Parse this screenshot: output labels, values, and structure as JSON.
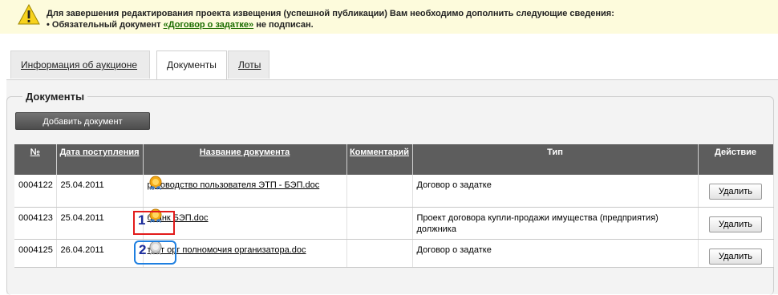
{
  "warning": {
    "line1": "Для завершения редактирования проекта извещения (успешной публикации) Вам необходимо дополнить следующие сведения:",
    "line2_prefix": "• Обязательный документ ",
    "line2_link": "«Договор о задатке»",
    "line2_suffix": " не подписан."
  },
  "tabs": [
    {
      "label": "Информация об аукционе",
      "active": false
    },
    {
      "label": "Документы",
      "active": true
    },
    {
      "label": "Лоты",
      "active": false
    }
  ],
  "section": {
    "title": "Документы",
    "add_button": "Добавить документ"
  },
  "table": {
    "headers": {
      "num": "№",
      "date": "Дата поступления",
      "name": "Название документа",
      "comment": "Комментарий",
      "type": "Тип",
      "action": "Действие"
    },
    "rows": [
      {
        "num": "0004122",
        "date": "25.04.2011",
        "name": "руководство пользователя ЭТП - БЭП.doc",
        "comment": "",
        "type": "Договор о задатке",
        "action": "Удалить",
        "signed": true
      },
      {
        "num": "0004123",
        "date": "25.04.2011",
        "name": "бланк БЭП.doc",
        "comment": "",
        "type": "Проект договора купли-продажи имущества (предприятия) должника",
        "action": "Удалить",
        "signed": true
      },
      {
        "num": "0004125",
        "date": "26.04.2011",
        "name": "тест орг полномочия организатора.doc",
        "comment": "",
        "type": "Договор о задатке",
        "action": "Удалить",
        "signed": false
      }
    ]
  },
  "annotations": {
    "marker1": "1",
    "marker2": "2"
  },
  "colors": {
    "warning_bg": "#fdfbdc",
    "link_green": "#1b6d00",
    "header_bg": "#5d5d5d",
    "marker1_border": "#e21b1b",
    "marker2_border": "#1e7fe0"
  }
}
